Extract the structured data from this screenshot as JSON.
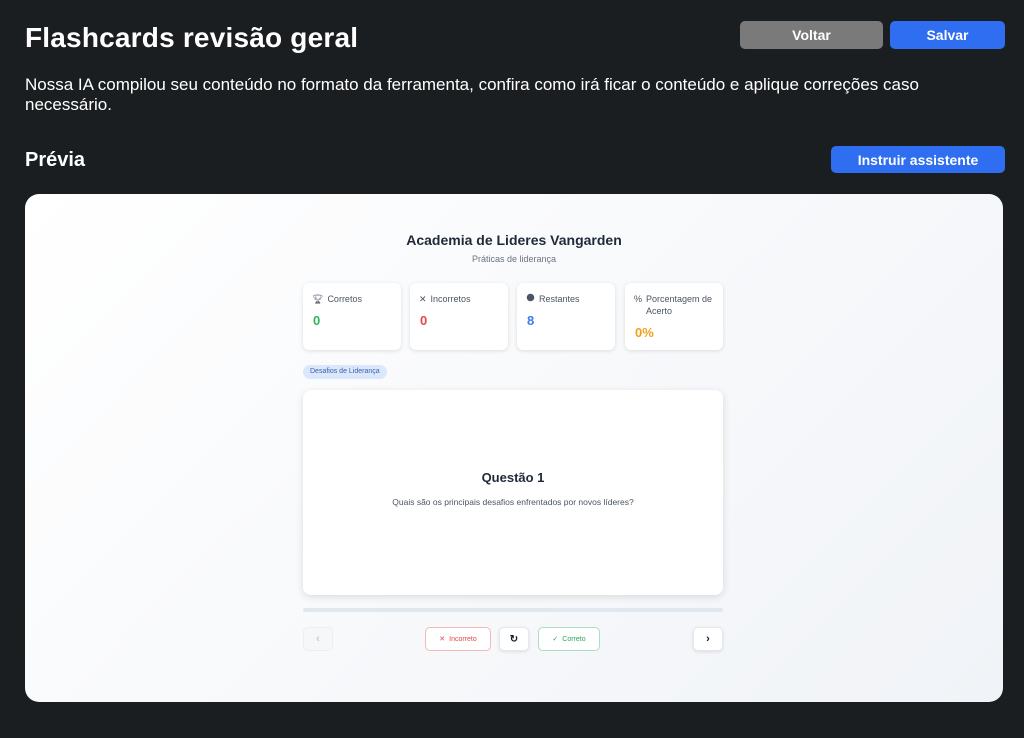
{
  "header": {
    "title": "Flashcards revisão geral",
    "back_label": "Voltar",
    "save_label": "Salvar",
    "description": "Nossa IA compilou seu conteúdo no formato da ferramenta, confira como irá ficar o conteúdo e aplique correções caso necessário."
  },
  "preview_section": {
    "title": "Prévia",
    "instruct_label": "Instruir assistente"
  },
  "preview": {
    "course_title": "Academia de Lideres Vangarden",
    "course_subtitle": "Práticas de liderança",
    "stats": [
      {
        "icon": "trophy-icon",
        "label": "Corretos",
        "value": "0",
        "color": "#2fb35a"
      },
      {
        "icon": "x-icon",
        "label": "Incorretos",
        "value": "0",
        "color": "#e04848"
      },
      {
        "icon": "brain-icon",
        "label": "Restantes",
        "value": "8",
        "color": "#3b7be8"
      },
      {
        "icon": "percent-icon",
        "label": "Porcentagem de Acerto",
        "value": "0%",
        "color": "#f0a11a"
      }
    ],
    "topic": "Desafios de Liderança",
    "card": {
      "title": "Questão 1",
      "question": "Quais são os principais desafios enfrentados por novos líderes?"
    },
    "progress_fraction": 0,
    "controls": {
      "incorrect_label": "Incorreto",
      "correct_label": "Correto",
      "prev_icon": "chevron-left-icon",
      "next_icon": "chevron-right-icon",
      "reset_icon": "refresh-icon"
    }
  },
  "colors": {
    "background": "#1b1e21",
    "primary": "#2f6ef0",
    "secondary_button": "#7a7a7a"
  }
}
